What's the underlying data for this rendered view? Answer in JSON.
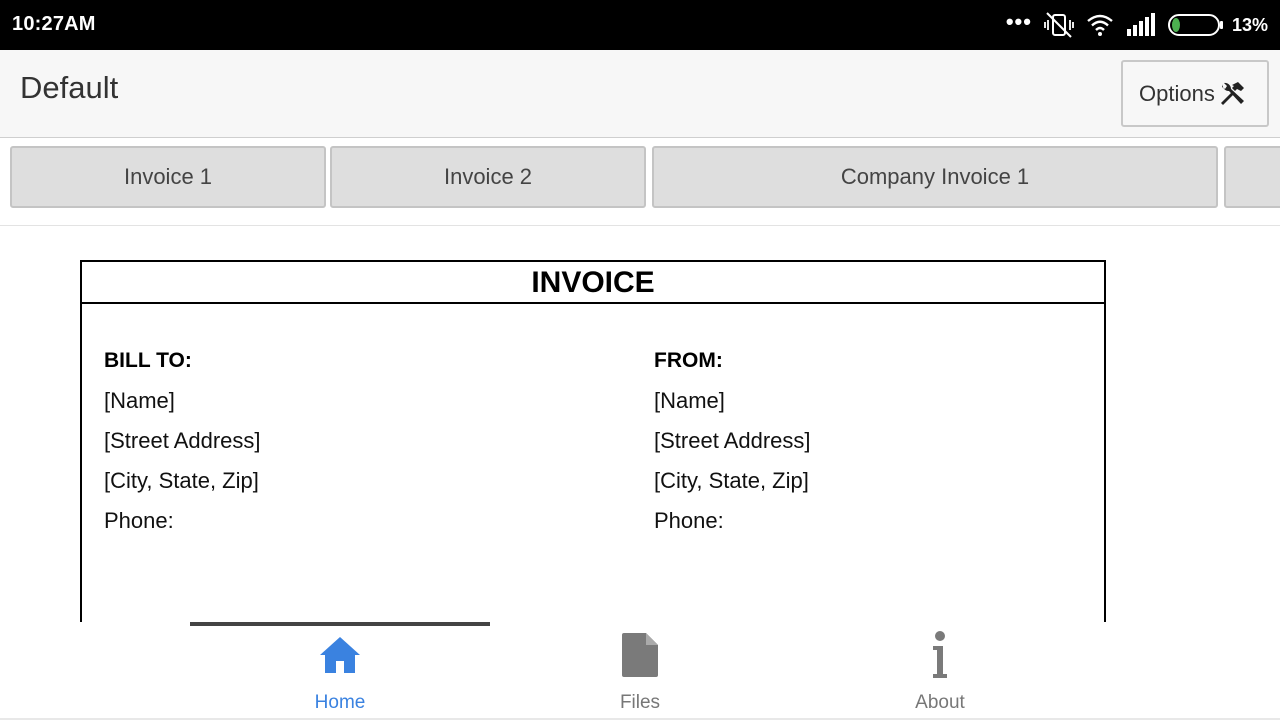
{
  "status_bar": {
    "time": "10:27AM",
    "battery_percent": "13%",
    "battery_level": 0.13,
    "icons": [
      "more-dots-icon",
      "vibrate-off-icon",
      "wifi-icon",
      "signal-icon",
      "battery-icon"
    ]
  },
  "app_bar": {
    "title": "Default",
    "options_label": "Options",
    "options_icon": "tools-icon"
  },
  "tabs": [
    {
      "label": "Invoice 1"
    },
    {
      "label": "Invoice 2"
    },
    {
      "label": "Company Invoice 1"
    },
    {
      "label": ""
    }
  ],
  "invoice": {
    "heading": "INVOICE",
    "bill_to": {
      "label": "BILL TO:",
      "name": "[Name]",
      "street": "[Street Address]",
      "city": "[City, State, Zip]",
      "phone": "Phone:"
    },
    "from": {
      "label": "FROM:",
      "name": "[Name]",
      "street": "[Street Address]",
      "city": "[City, State, Zip]",
      "phone": "Phone:"
    }
  },
  "bottom_nav": {
    "items": [
      {
        "label": "Home",
        "icon": "home-icon",
        "active": true
      },
      {
        "label": "Files",
        "icon": "file-icon",
        "active": false
      },
      {
        "label": "About",
        "icon": "info-icon",
        "active": false
      }
    ]
  },
  "colors": {
    "accent": "#3a82e0",
    "inactive_icon": "#7a7a7a",
    "battery_green": "#4caf50"
  }
}
